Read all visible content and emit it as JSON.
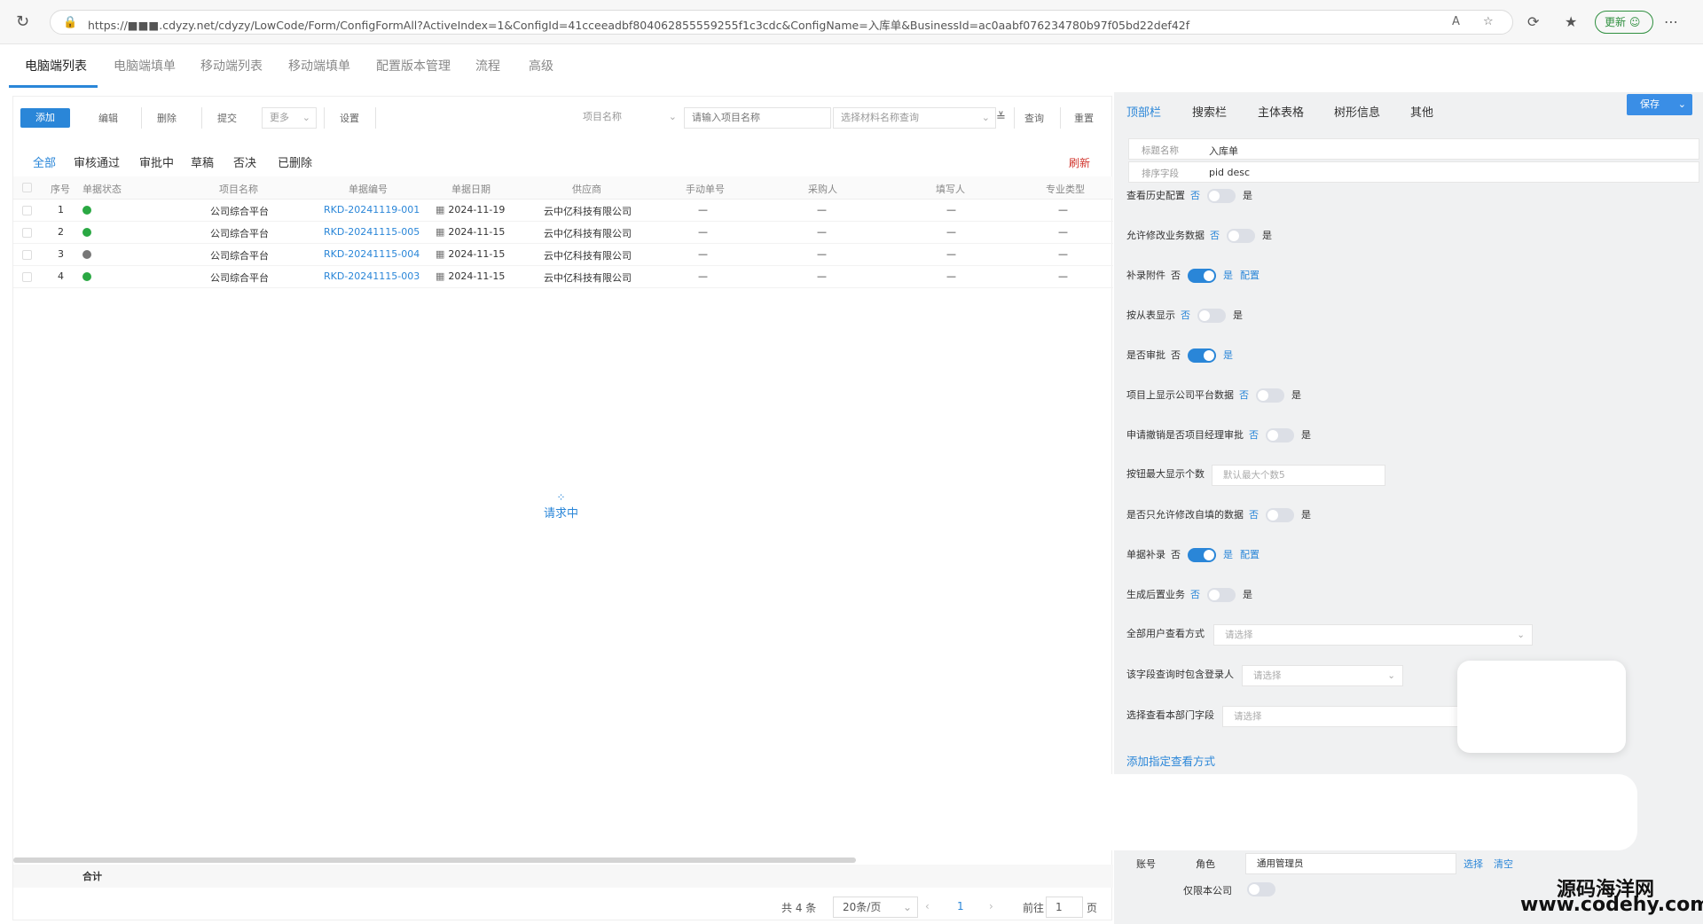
{
  "browser": {
    "url": "https://■■■.cdyzy.net/cdyzy/LowCode/Form/ConfigFormAll?ActiveIndex=1&ConfigId=41cceeadbf804062855559255f1c3cdc&ConfigName=入库单&BusinessId=ac0aabf076234780b97f05bd22def42f",
    "update_label": "更新"
  },
  "tabs": [
    "电脑端列表",
    "电脑端填单",
    "移动端列表",
    "移动端填单",
    "配置版本管理",
    "流程",
    "高级"
  ],
  "toolbar": {
    "add": "添加",
    "edit": "编辑",
    "delete": "删除",
    "submit": "提交",
    "more": "更多",
    "settings": "设置",
    "project_label": "项目名称",
    "project_placeholder": "请输入项目名称",
    "material_placeholder": "选择材料名称查询",
    "query": "查询",
    "reset": "重置"
  },
  "filters": [
    "全部",
    "审核通过",
    "审批中",
    "草稿",
    "否决",
    "已删除"
  ],
  "refresh_label": "刷新",
  "table": {
    "headers": [
      "序号",
      "单据状态",
      "项目名称",
      "单据编号",
      "单据日期",
      "供应商",
      "手动单号",
      "采购人",
      "填写人",
      "专业类型"
    ],
    "rows": [
      {
        "no": "1",
        "project": "公司综合平台",
        "code": "RKD-20241119-001",
        "date": "2024-11-19",
        "supplier": "云中亿科技有限公司",
        "manual": "—",
        "buyer": "—",
        "writer": "—",
        "type": "—",
        "status_color": "#2aa843"
      },
      {
        "no": "2",
        "project": "公司综合平台",
        "code": "RKD-20241115-005",
        "date": "2024-11-15",
        "supplier": "云中亿科技有限公司",
        "manual": "—",
        "buyer": "—",
        "writer": "—",
        "type": "—",
        "status_color": "#2aa843"
      },
      {
        "no": "3",
        "project": "公司综合平台",
        "code": "RKD-20241115-004",
        "date": "2024-11-15",
        "supplier": "云中亿科技有限公司",
        "manual": "—",
        "buyer": "—",
        "writer": "—",
        "type": "—",
        "status_color": "#777777"
      },
      {
        "no": "4",
        "project": "公司综合平台",
        "code": "RKD-20241115-003",
        "date": "2024-11-15",
        "supplier": "云中亿科技有限公司",
        "manual": "—",
        "buyer": "—",
        "writer": "—",
        "type": "—",
        "status_color": "#2aa843"
      }
    ],
    "loading": "请求中",
    "sum_label": "合计"
  },
  "pager": {
    "total": "共 4 条",
    "page_size": "20条/页",
    "current": "1",
    "goto": "前往",
    "goto_value": "1",
    "page_unit": "页"
  },
  "right": {
    "tabs": [
      "顶部栏",
      "搜索栏",
      "主体表格",
      "树形信息",
      "其他"
    ],
    "save": "保存",
    "title_label": "标题名称",
    "title_value": "入库单",
    "sort_label": "排序字段",
    "sort_value": "pid desc",
    "options": [
      {
        "label": "查看历史配置",
        "no": "否",
        "yes": "是",
        "on": false,
        "config": ""
      },
      {
        "label": "允许修改业务数据",
        "no": "否",
        "yes": "是",
        "on": false,
        "config": ""
      },
      {
        "label": "补录附件",
        "no": "否",
        "yes": "是",
        "on": true,
        "config": "配置"
      },
      {
        "label": "按从表显示",
        "no": "否",
        "yes": "是",
        "on": false,
        "config": ""
      },
      {
        "label": "是否审批",
        "no": "否",
        "yes": "是",
        "on": true,
        "config": ""
      },
      {
        "label": "项目上显示公司平台数据",
        "no": "否",
        "yes": "是",
        "on": false,
        "config": ""
      },
      {
        "label": "申请撤销是否项目经理审批",
        "no": "否",
        "yes": "是",
        "on": false,
        "config": ""
      }
    ],
    "max_btn_label": "按钮最大显示个数",
    "max_btn_placeholder": "默认最大个数5",
    "options2": [
      {
        "label": "是否只允许修改自填的数据",
        "no": "否",
        "yes": "是",
        "on": false,
        "config": ""
      },
      {
        "label": "单据补录",
        "no": "否",
        "yes": "是",
        "on": true,
        "config": "配置"
      },
      {
        "label": "生成后置业务",
        "no": "否",
        "yes": "是",
        "on": false,
        "config": ""
      }
    ],
    "view_mode_label": "全部用户查看方式",
    "view_mode_placeholder": "请选择",
    "login_label": "该字段查询时包含登录人",
    "login_placeholder": "请选择",
    "dept_label": "选择查看本部门字段",
    "dept_placeholder": "请选择",
    "add_view_link": "添加指定查看方式",
    "account_label": "账号",
    "role_label": "角色",
    "role_value": "通用管理员",
    "select": "选择",
    "clear": "清空",
    "company_only_label": "仅限本公司"
  },
  "watermark": {
    "line1": "源码海洋网",
    "line2": "www.codehy.com"
  }
}
